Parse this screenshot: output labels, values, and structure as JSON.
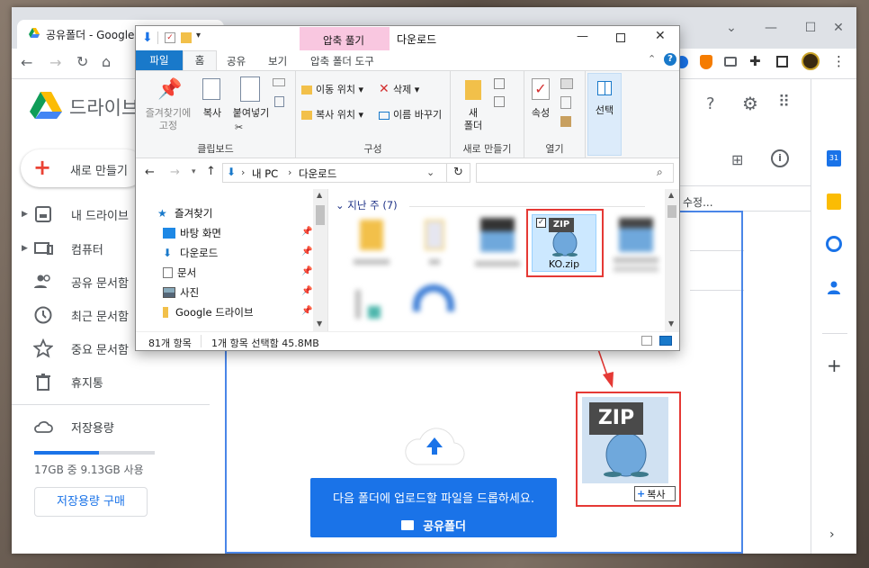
{
  "browser": {
    "tab_title": "공유폴더 - Google",
    "window_minimize": "—",
    "window_maximize": "☐",
    "window_close": "✕"
  },
  "drive": {
    "logo_text": "드라이브",
    "new_button": "새로 만들기",
    "nav": [
      {
        "label": "내 드라이브",
        "icon": "drive-icon"
      },
      {
        "label": "컴퓨터",
        "icon": "computer-icon"
      },
      {
        "label": "공유 문서함",
        "icon": "shared-icon"
      },
      {
        "label": "최근 문서함",
        "icon": "clock-icon"
      },
      {
        "label": "중요 문서함",
        "icon": "star-icon"
      },
      {
        "label": "휴지통",
        "icon": "trash-icon"
      }
    ],
    "storage_label": "저장용량",
    "storage_used_text": "17GB 중 9.13GB 사용",
    "storage_fraction": 0.54,
    "buy_storage": "저장용량 구매",
    "column_modified": "수정..."
  },
  "explorer": {
    "context_tab": "압축 풀기",
    "window_title": "다운로드",
    "ribbon_tabs": [
      "파일",
      "홈",
      "공유",
      "보기",
      "압축 폴더 도구"
    ],
    "ribbon": {
      "pin": "즐겨찾기에\n고정",
      "copy": "복사",
      "paste": "붙여넣기",
      "clipboard_group": "클립보드",
      "move_to": "이동 위치",
      "copy_to": "복사 위치",
      "delete": "삭제",
      "rename": "이름 바꾸기",
      "organize_group": "구성",
      "new_folder": "새\n폴더",
      "new_group": "새로 만들기",
      "properties": "속성",
      "open_group": "열기",
      "select": "선택"
    },
    "breadcrumb": [
      "내 PC",
      "다운로드"
    ],
    "sidebar": [
      {
        "label": "즐겨찾기",
        "pin": false
      },
      {
        "label": "바탕 화면",
        "pin": true
      },
      {
        "label": "다운로드",
        "pin": true
      },
      {
        "label": "문서",
        "pin": true
      },
      {
        "label": "사진",
        "pin": true
      },
      {
        "label": "Google 드라이브",
        "pin": true
      }
    ],
    "group_header": "지난 주 (7)",
    "selected_file": "KO.zip",
    "zip_badge": "ZIP",
    "status_items": "81개 항목",
    "status_selected": "1개 항목 선택함 45.8MB"
  },
  "drag": {
    "zip_badge": "ZIP",
    "copy_hint": "복사"
  },
  "drop": {
    "message": "다음 폴더에 업로드할 파일을 드롭하세요.",
    "folder": "공유폴더"
  },
  "colors": {
    "accent_blue": "#1a73e8",
    "highlight_red": "#e53935",
    "ribbon_context": "#f9c7e0"
  }
}
